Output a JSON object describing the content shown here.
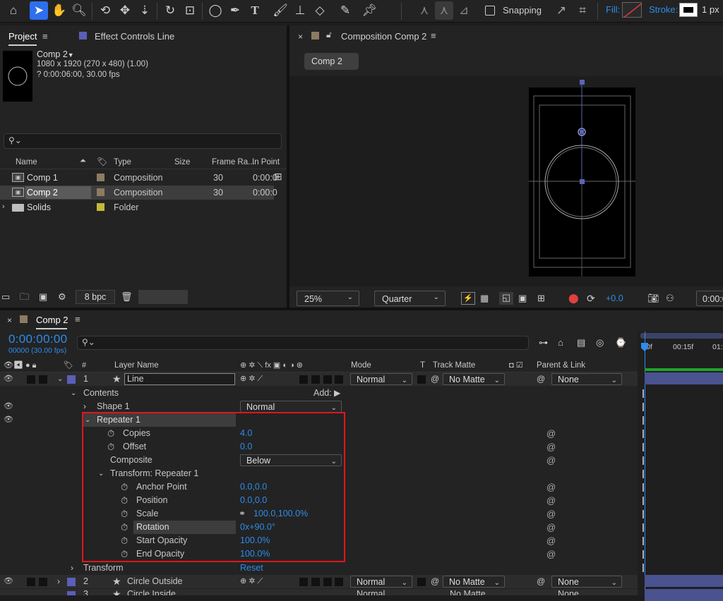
{
  "toolbar": {
    "snapping": "Snapping",
    "fill_label": "Fill:",
    "stroke_label": "Stroke:",
    "stroke_width": "1 px"
  },
  "project": {
    "tab": "Project",
    "tab2": "Effect Controls Line",
    "comp_name": "Comp 2",
    "comp_size": "1080 x 1920  (270 x 480) (1.00)",
    "comp_duration": "? 0:00:06:00, 30.00 fps",
    "search_placeholder": "",
    "columns": {
      "name": "Name",
      "type": "Type",
      "size": "Size",
      "frame_rate": "Frame Ra...",
      "in_point": "In Point"
    },
    "items": [
      {
        "name": "Comp 1",
        "type": "Composition",
        "frame_rate": "30",
        "in_point": "0:00:0",
        "color": "#8c7b62"
      },
      {
        "name": "Comp 2",
        "type": "Composition",
        "frame_rate": "30",
        "in_point": "0:00:0",
        "color": "#8c7b62"
      },
      {
        "name": "Solids",
        "type": "Folder",
        "frame_rate": "",
        "in_point": "",
        "color": "#c4b83a"
      }
    ],
    "bpc": "8 bpc"
  },
  "composition": {
    "tab": "Composition Comp 2",
    "crumb": "Comp 2",
    "zoom": "25%",
    "resolution": "Quarter",
    "exposure": "+0.0",
    "timecode": "0:00:0"
  },
  "timeline": {
    "tab": "Comp 2",
    "timecode": "0:00:00:00",
    "frames": "00000 (30.00 fps)",
    "columns": {
      "layer_name": "Layer Name",
      "mode": "Mode",
      "t": "T",
      "track_matte": "Track Matte",
      "parent_link": "Parent & Link",
      "num": "#"
    },
    "ruler": [
      "0f",
      "00:15f",
      "01:"
    ],
    "layer1": {
      "num": "1",
      "name": "Line",
      "mode": "Normal",
      "matte": "No Matte",
      "parent": "None"
    },
    "contents": "Contents",
    "add": "Add:",
    "shape1": "Shape 1",
    "shape1_mode": "Normal",
    "repeater": "Repeater 1",
    "props": [
      {
        "label": "Copies",
        "value": "4.0"
      },
      {
        "label": "Offset",
        "value": "0.0"
      }
    ],
    "composite_label": "Composite",
    "composite_value": "Below",
    "transform_repeater": "Transform: Repeater 1",
    "tprops": [
      {
        "label": "Anchor Point",
        "value": "0.0,0.0"
      },
      {
        "label": "Position",
        "value": "0.0,0.0"
      },
      {
        "label": "Scale",
        "value": "100.0,100.0%"
      },
      {
        "label": "Rotation",
        "value": "0x+90.0°"
      },
      {
        "label": "Start Opacity",
        "value": "100.0%"
      },
      {
        "label": "End Opacity",
        "value": "100.0%"
      }
    ],
    "transform": "Transform",
    "reset": "Reset",
    "layer2": {
      "num": "2",
      "name": "Circle Outside",
      "mode": "Normal",
      "matte": "No Matte",
      "parent": "None"
    },
    "layer3": {
      "num": "3",
      "name": "Circle Inside",
      "mode": "Normal",
      "matte": "No Matte",
      "parent": "None"
    }
  }
}
